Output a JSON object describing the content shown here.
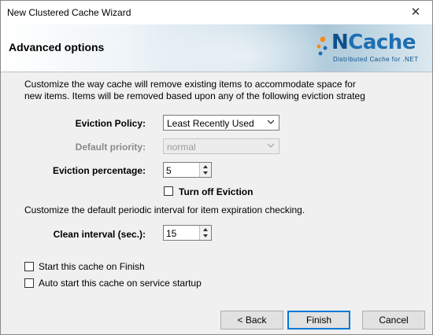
{
  "window": {
    "title": "New Clustered Cache Wizard",
    "close_glyph": "✕"
  },
  "header": {
    "title": "Advanced options",
    "logo": {
      "prefix": "N",
      "main": "Cache",
      "subtitle": "Distributed  Cache  for  .NET"
    }
  },
  "intro_text": {
    "line1": "Customize the way cache will remove existing items to accommodate space for",
    "line2": "new items. Items will be removed based upon any of the following eviction strateg"
  },
  "eviction_policy": {
    "label": "Eviction Policy:",
    "value": "Least Recently Used"
  },
  "default_priority": {
    "label": "Default priority:",
    "value": "normal",
    "enabled": false
  },
  "eviction_percentage": {
    "label": "Eviction percentage:",
    "value": "5"
  },
  "turn_off_eviction": {
    "label": "Turn off Eviction",
    "checked": false
  },
  "interval_text": "Customize the default periodic interval for item expiration checking.",
  "clean_interval": {
    "label": "Clean interval (sec.):",
    "value": "15"
  },
  "start_on_finish": {
    "label": "Start this cache on Finish",
    "checked": false
  },
  "auto_start": {
    "label": "Auto start this cache on service startup",
    "checked": false
  },
  "buttons": {
    "back": "< Back",
    "finish": "Finish",
    "cancel": "Cancel"
  },
  "colors": {
    "accent": "#0078d7",
    "logo_blue": "#1f6fb2",
    "logo_orange": "#f28c1e"
  }
}
